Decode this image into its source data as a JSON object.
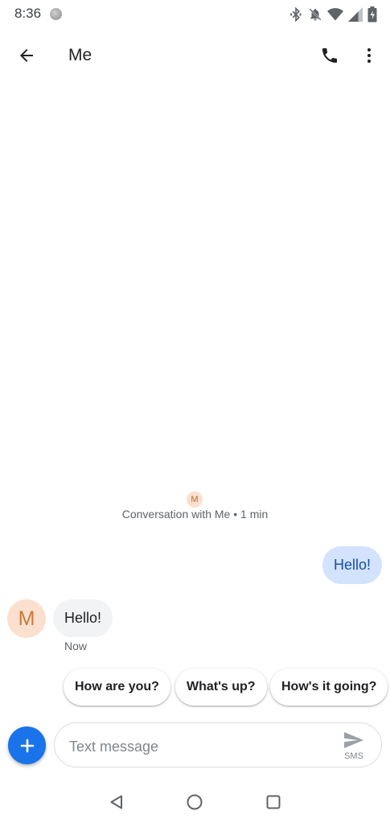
{
  "status_bar": {
    "time": "8:36",
    "icons": [
      "bluetooth-icon",
      "notifications-off-icon",
      "wifi-icon",
      "signal-icon",
      "battery-icon"
    ]
  },
  "app_bar": {
    "title": "Me",
    "icons": [
      "back-arrow-icon",
      "phone-icon",
      "more-vert-icon"
    ]
  },
  "conversation": {
    "avatar_letter": "M",
    "info": "Conversation with Me • 1 min"
  },
  "messages": [
    {
      "direction": "outgoing",
      "text": "Hello!"
    },
    {
      "direction": "incoming",
      "text": "Hello!",
      "time": "Now",
      "avatar_letter": "M"
    }
  ],
  "smart_replies": [
    "How are you?",
    "What's up?",
    "How's it going?"
  ],
  "compose": {
    "placeholder": "Text message",
    "send_label": "SMS"
  },
  "nav_bar": {
    "icons": [
      "back-triangle-icon",
      "home-circle-icon",
      "recents-square-icon"
    ]
  },
  "colors": {
    "accent": "#1a73e8",
    "outgoing_bubble": "#d3e3fd",
    "incoming_bubble": "#f1f3f4",
    "avatar_bg": "#fbe0cf"
  }
}
